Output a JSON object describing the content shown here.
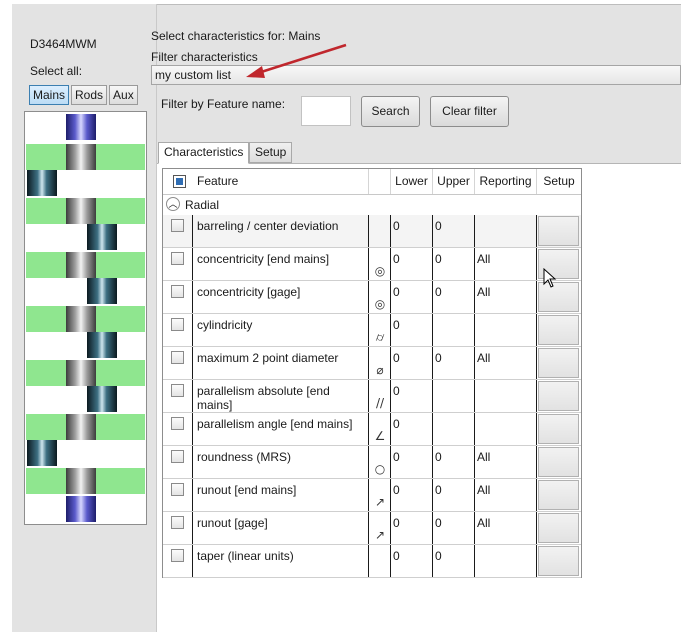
{
  "left_panel": {
    "model_id": "D3464MWM",
    "select_all_label": "Select all:",
    "group_buttons": [
      {
        "label": "Mains",
        "active": true
      },
      {
        "label": "Rods",
        "active": false
      },
      {
        "label": "Aux",
        "active": false
      }
    ]
  },
  "header": {
    "title": "Select characteristics for:  Mains",
    "filter_label": "Filter characteristics",
    "filter_value": "my custom list"
  },
  "feature_filter": {
    "label": "Filter by Feature name:",
    "input_value": "",
    "search_label": "Search",
    "clear_label": "Clear filter"
  },
  "tabs": [
    {
      "label": "Characteristics",
      "active": true
    },
    {
      "label": "Setup",
      "active": false
    }
  ],
  "grid": {
    "columns": {
      "feature": "Feature",
      "lower": "Lower",
      "upper": "Upper",
      "reporting": "Reporting",
      "setup": "Setup"
    },
    "group_name": "Radial",
    "rows": [
      {
        "feature": "barreling  / center deviation",
        "symbol": "",
        "lower": "0",
        "upper": "0",
        "reporting": ""
      },
      {
        "feature": "concentricity [end mains]",
        "symbol": "◎",
        "lower": "0",
        "upper": "0",
        "reporting": "All"
      },
      {
        "feature": "concentricity [gage]",
        "symbol": "◎",
        "lower": "0",
        "upper": "0",
        "reporting": "All"
      },
      {
        "feature": "cylindricity",
        "symbol": "⌭",
        "lower": "0",
        "upper": "",
        "reporting": ""
      },
      {
        "feature": "maximum 2 point diameter",
        "symbol": "⌀",
        "lower": "0",
        "upper": "0",
        "reporting": "All"
      },
      {
        "feature": "parallelism absolute [end mains]",
        "symbol": "//",
        "lower": "0",
        "upper": "",
        "reporting": ""
      },
      {
        "feature": "parallelism angle [end mains]",
        "symbol": "∠",
        "lower": "0",
        "upper": "",
        "reporting": ""
      },
      {
        "feature": "roundness (MRS)",
        "symbol": "○",
        "lower": "0",
        "upper": "0",
        "reporting": "All"
      },
      {
        "feature": "runout [end mains]",
        "symbol": "↗",
        "lower": "0",
        "upper": "0",
        "reporting": "All"
      },
      {
        "feature": "runout [gage]",
        "symbol": "↗",
        "lower": "0",
        "upper": "0",
        "reporting": "All"
      },
      {
        "feature": "taper (linear units)",
        "symbol": "",
        "lower": "0",
        "upper": "0",
        "reporting": ""
      }
    ]
  },
  "colors": {
    "panel_bg": "#e3e3e3",
    "journal_green": "#8fe68f",
    "annotation_arrow": "#c0272d",
    "active_button": "#bcdcf5"
  }
}
